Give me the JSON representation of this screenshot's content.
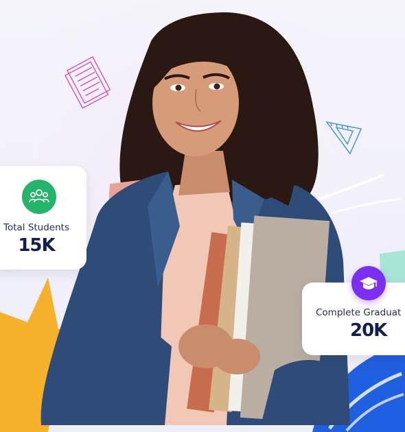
{
  "stats": [
    {
      "label": "Total Students",
      "value": "15K",
      "icon": "users-icon",
      "color": "#24b46a"
    },
    {
      "label": "Complete Graduat",
      "value": "20K",
      "icon": "graduation-cap-icon",
      "color": "#7b2ff2"
    }
  ],
  "colors": {
    "background": "#f3f2fa",
    "title_navy": "#0f1f4f",
    "accent_yellow": "#f6b12a",
    "accent_blue": "#1f5fe0",
    "accent_mint": "#9fe0cf"
  }
}
